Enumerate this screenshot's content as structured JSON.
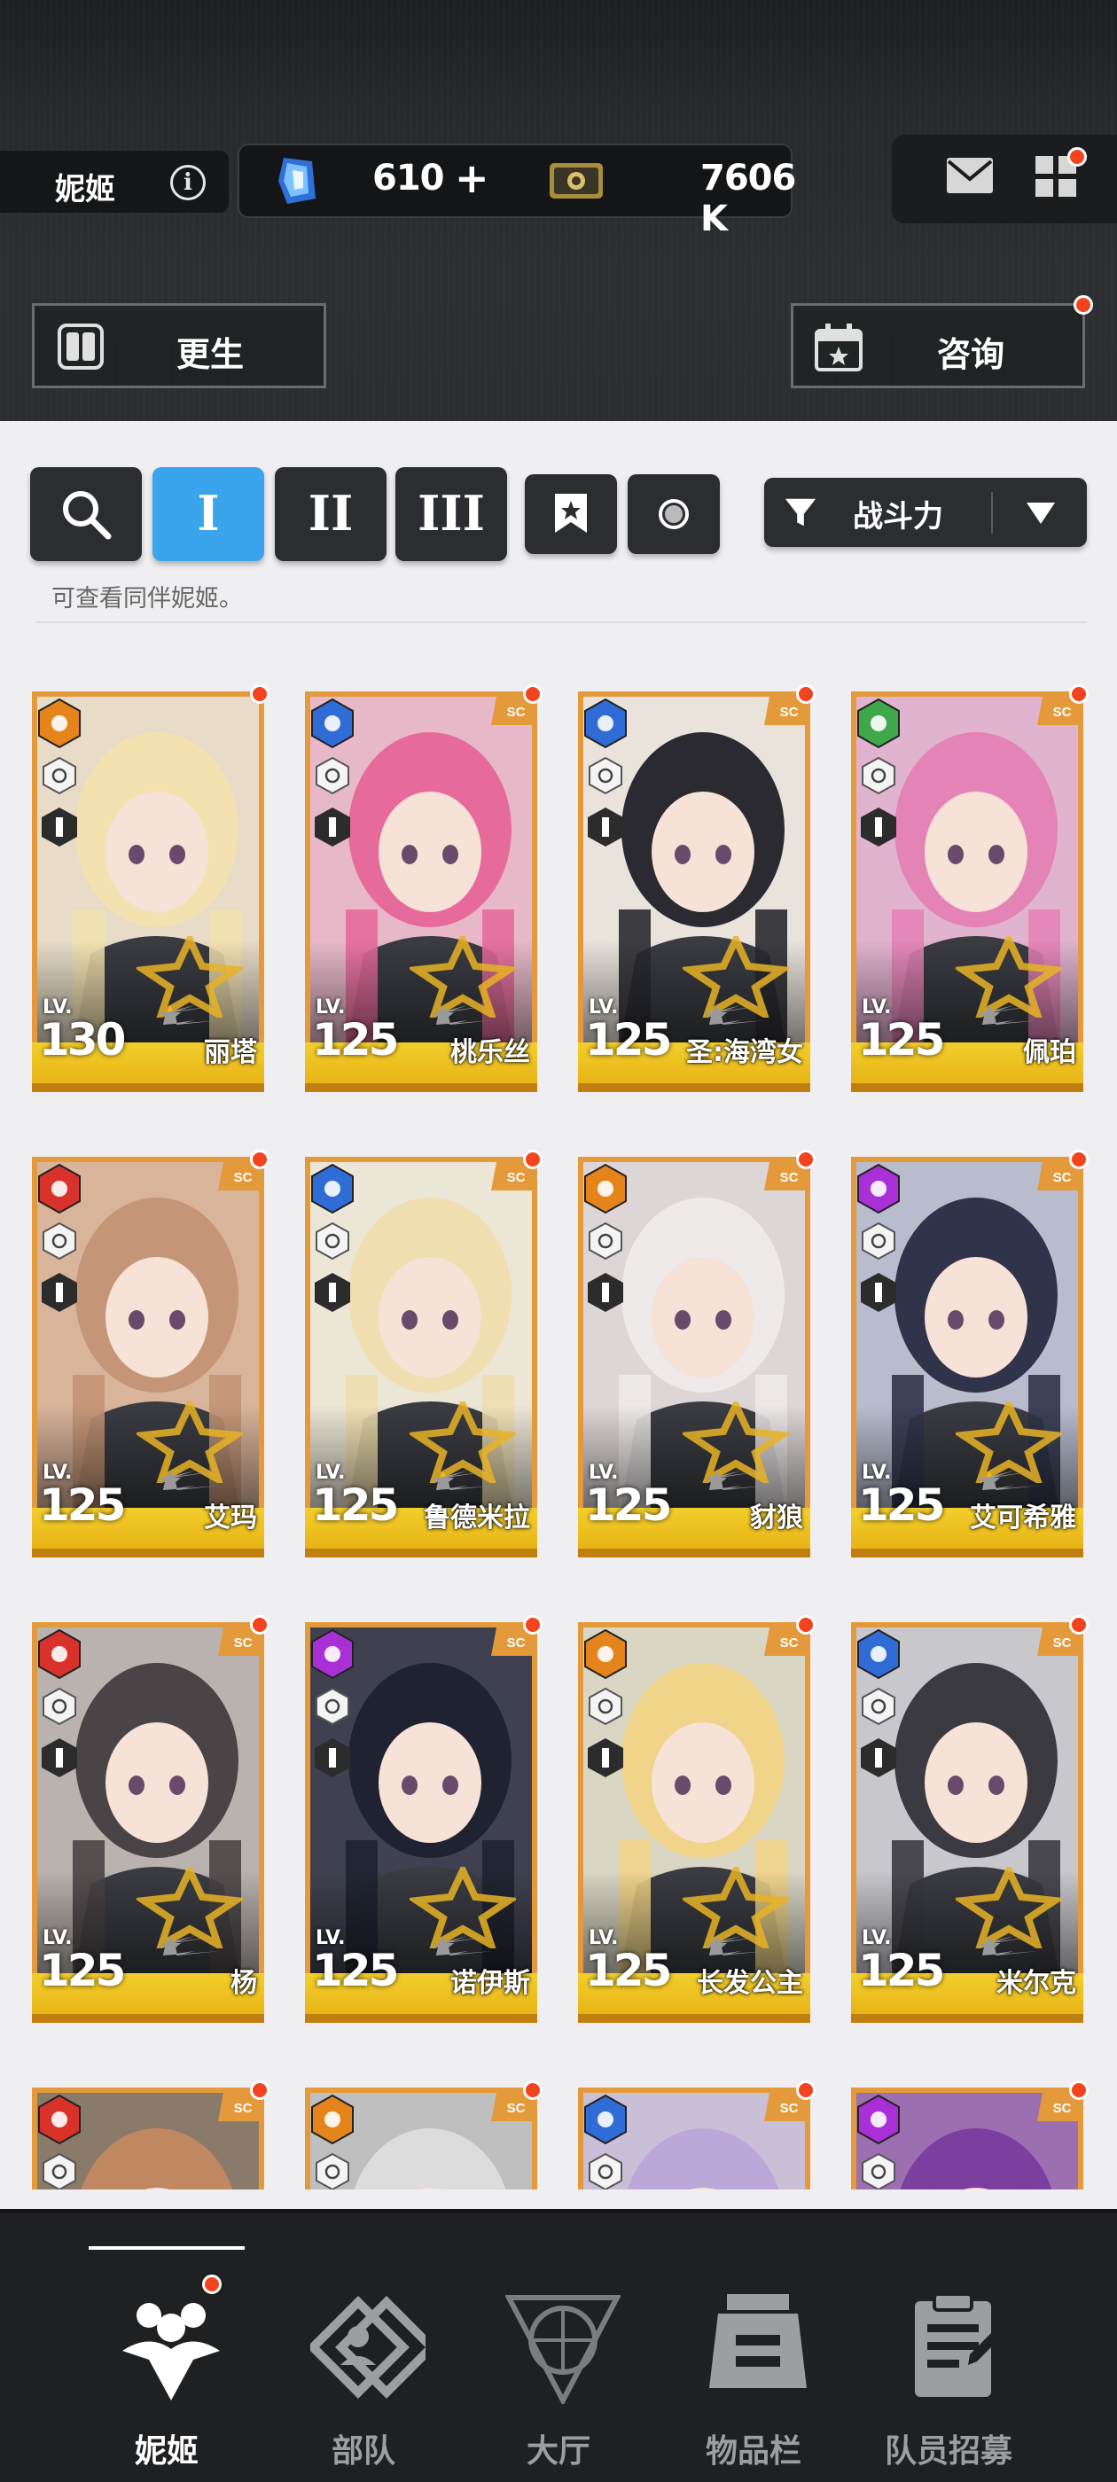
{
  "header": {
    "tab_name": "妮姬",
    "gem_amount": "610",
    "gem_plus": "+",
    "credit_amount": "7606 K"
  },
  "actions": {
    "rebirth_label": "更生",
    "consult_label": "咨询"
  },
  "filters": {
    "tier_labels": [
      "I",
      "II",
      "III"
    ],
    "active_tier": "I",
    "sort_label": "战斗力",
    "hint": "可查看同伴妮姬。"
  },
  "cards": [
    {
      "name": "丽塔",
      "lv_label": "LV.",
      "level": "130",
      "element": "iron",
      "element_color": "#e6841c",
      "rank": "I",
      "stars": 1,
      "sc": false
    },
    {
      "name": "桃乐丝",
      "lv_label": "LV.",
      "level": "125",
      "element": "water",
      "element_color": "#2f6cd6",
      "rank": "I",
      "stars": 0,
      "sc": true
    },
    {
      "name": "圣:海湾女",
      "lv_label": "LV.",
      "level": "125",
      "element": "water",
      "element_color": "#2f6cd6",
      "rank": "I",
      "stars": 0,
      "sc": true
    },
    {
      "name": "佩珀",
      "lv_label": "LV.",
      "level": "125",
      "element": "wind",
      "element_color": "#3ea84a",
      "rank": "I",
      "stars": 0,
      "sc": true
    },
    {
      "name": "艾玛",
      "lv_label": "LV.",
      "level": "125",
      "element": "fire",
      "element_color": "#d9322a",
      "rank": "I",
      "stars": 0,
      "sc": true
    },
    {
      "name": "鲁德米拉",
      "lv_label": "LV.",
      "level": "125",
      "element": "water",
      "element_color": "#2f6cd6",
      "rank": "I",
      "stars": 1,
      "sc": true
    },
    {
      "name": "豺狼",
      "lv_label": "LV.",
      "level": "125",
      "element": "iron",
      "element_color": "#e6841c",
      "rank": "I",
      "stars": 0,
      "sc": true
    },
    {
      "name": "艾可希雅",
      "lv_label": "LV.",
      "level": "125",
      "element": "electric",
      "element_color": "#a92fd6",
      "rank": "I",
      "stars": 1,
      "sc": true
    },
    {
      "name": "杨",
      "lv_label": "LV.",
      "level": "125",
      "element": "fire",
      "element_color": "#d9322a",
      "rank": "I",
      "stars": 0,
      "sc": true
    },
    {
      "name": "诺伊斯",
      "lv_label": "LV.",
      "level": "125",
      "element": "electric",
      "element_color": "#a92fd6",
      "rank": "I",
      "stars": 0,
      "sc": true
    },
    {
      "name": "长发公主",
      "lv_label": "LV.",
      "level": "125",
      "element": "iron",
      "element_color": "#e6841c",
      "rank": "I",
      "stars": 0,
      "sc": true
    },
    {
      "name": "米尔克",
      "lv_label": "LV.",
      "level": "125",
      "element": "water",
      "element_color": "#2f6cd6",
      "rank": "I",
      "stars": 0,
      "sc": true
    },
    {
      "name": "",
      "lv_label": "",
      "level": "",
      "element": "fire",
      "element_color": "#d9322a",
      "rank": "",
      "stars": 0,
      "sc": true
    },
    {
      "name": "",
      "lv_label": "",
      "level": "",
      "element": "iron",
      "element_color": "#e6841c",
      "rank": "",
      "stars": 0,
      "sc": true
    },
    {
      "name": "",
      "lv_label": "",
      "level": "",
      "element": "water",
      "element_color": "#2f6cd6",
      "rank": "",
      "stars": 0,
      "sc": true
    },
    {
      "name": "",
      "lv_label": "",
      "level": "",
      "element": "electric",
      "element_color": "#a92fd6",
      "rank": "",
      "stars": 0,
      "sc": true
    }
  ],
  "nav": [
    {
      "label": "妮姬",
      "icon": "nikke-icon",
      "active": true
    },
    {
      "label": "部队",
      "icon": "squad-icon",
      "active": false
    },
    {
      "label": "大厅",
      "icon": "lobby-icon",
      "active": false
    },
    {
      "label": "物品栏",
      "icon": "inventory-icon",
      "active": false
    },
    {
      "label": "队员招募",
      "icon": "recruit-icon",
      "active": false
    }
  ],
  "colors": {
    "accent_blue": "#3aa4ec",
    "card_gold": "#e5ae12",
    "card_frame": "#e49a3a",
    "badge_red": "#f4431f"
  }
}
